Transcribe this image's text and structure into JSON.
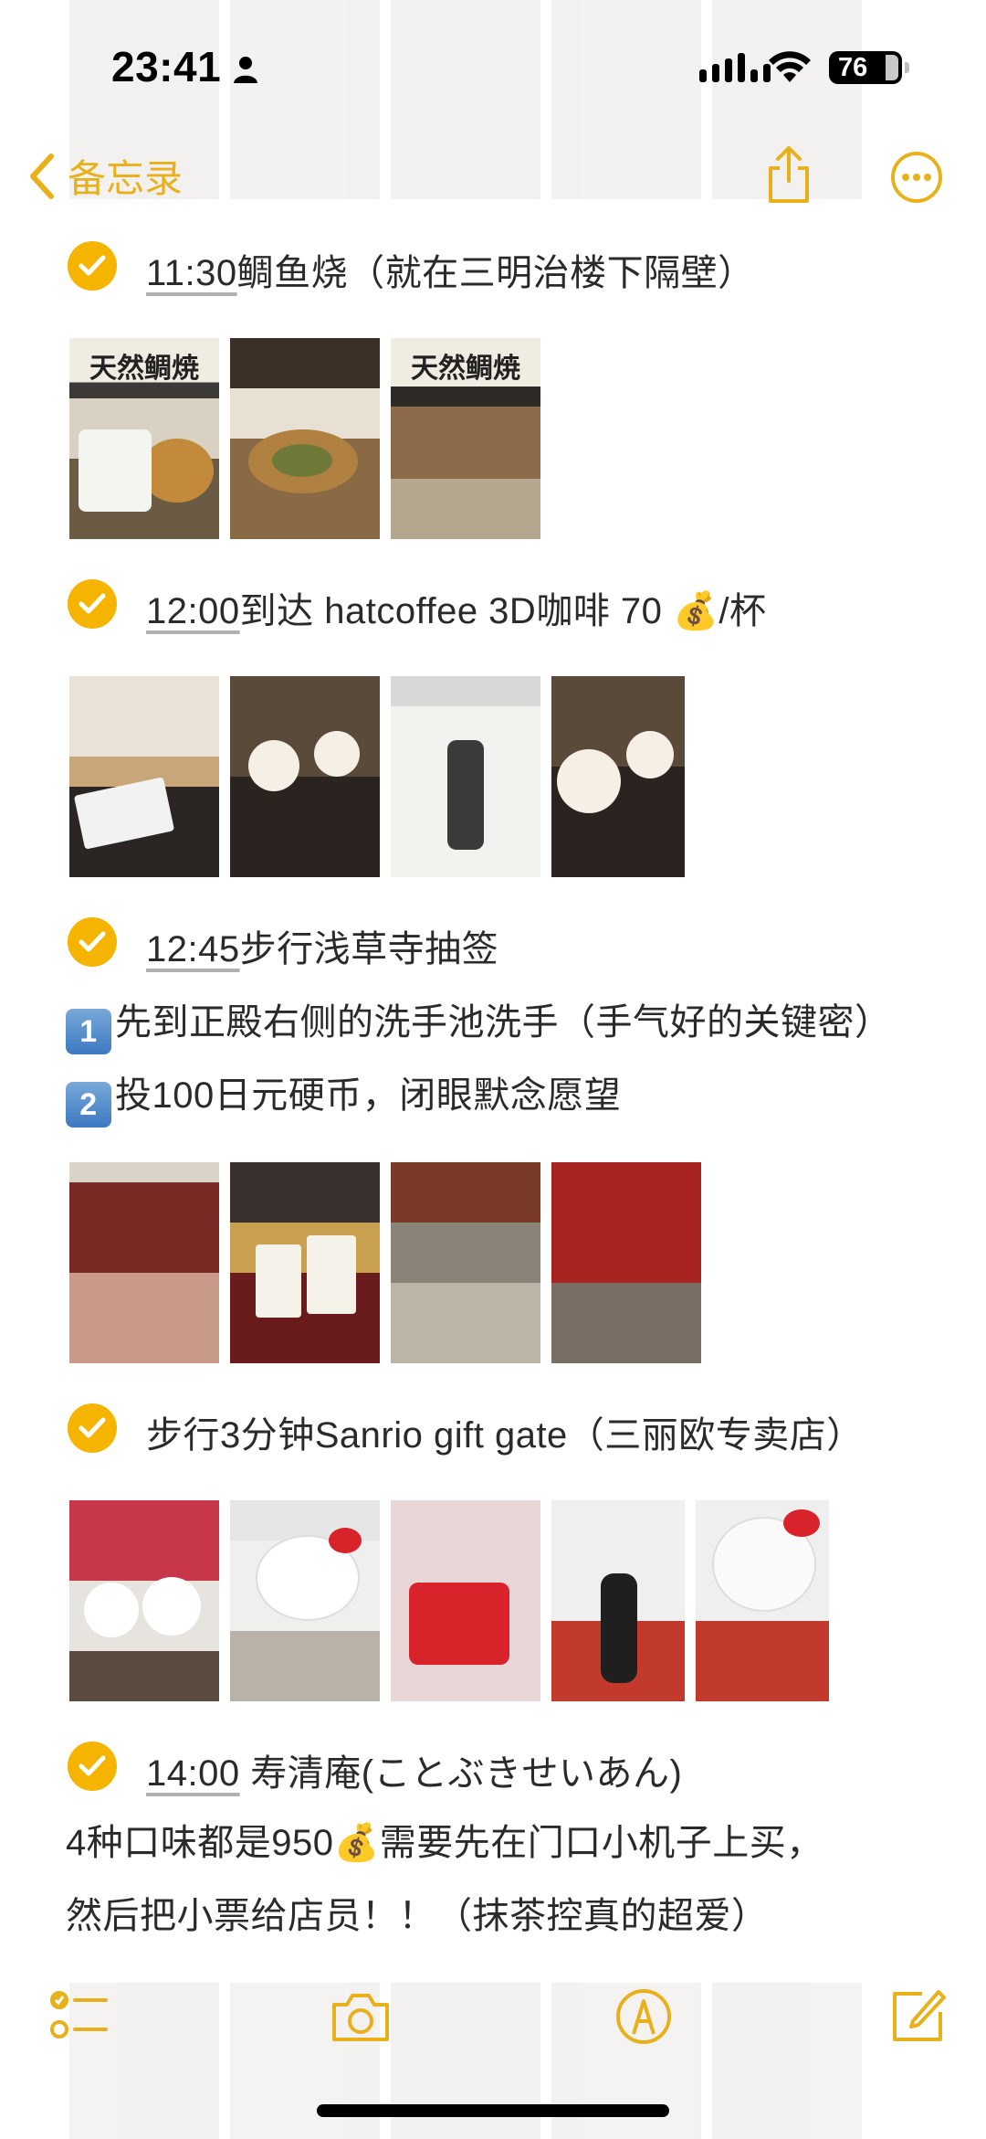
{
  "status_bar": {
    "time": "23:41",
    "battery": "76"
  },
  "nav": {
    "back_label": "备忘录"
  },
  "items": [
    {
      "time": "11:30",
      "text": "鲷鱼烧（就在三明治楼下隔壁）",
      "photos": [
        {
          "caption": "天然鲷焼"
        },
        {
          "caption": ""
        },
        {
          "caption": "天然鲷焼"
        }
      ]
    },
    {
      "time": "12:00",
      "text": "到达 hatcoffee 3D咖啡 70",
      "suffix": "/杯",
      "photos": [
        {
          "caption": ""
        },
        {
          "caption": ""
        },
        {
          "caption": ""
        },
        {
          "caption": ""
        }
      ]
    },
    {
      "time": "12:45",
      "text": "步行浅草寺抽签",
      "steps": [
        {
          "num": "1",
          "text": "先到正殿右侧的洗手池洗手（手气好的关键密）"
        },
        {
          "num": "2",
          "text": "投100日元硬币，闭眼默念愿望"
        }
      ],
      "photos": [
        {
          "caption": ""
        },
        {
          "caption": ""
        },
        {
          "caption": ""
        },
        {
          "caption": ""
        }
      ]
    },
    {
      "time": "",
      "text": "步行3分钟Sanrio gift gate（三丽欧专卖店）",
      "photos": [
        {
          "caption": ""
        },
        {
          "caption": ""
        },
        {
          "caption": ""
        },
        {
          "caption": ""
        },
        {
          "caption": ""
        }
      ]
    },
    {
      "time": "14:00",
      "text": " 寿清庵(ことぶきせいあん)",
      "lines": [
        {
          "text": "4种口味都是950",
          "suffix": "需要先在门口小机子上买，"
        },
        {
          "text": "然后把小票给店员！！（抹茶控真的超爱）"
        }
      ]
    }
  ],
  "icons": {
    "checked": "checkmark-circle-icon",
    "money": "money-bag-icon"
  },
  "colors": {
    "accent": "#f5b400",
    "accent_text": "#e8b11c",
    "text": "#2a2a2a",
    "keycap": "#4a86c8"
  }
}
